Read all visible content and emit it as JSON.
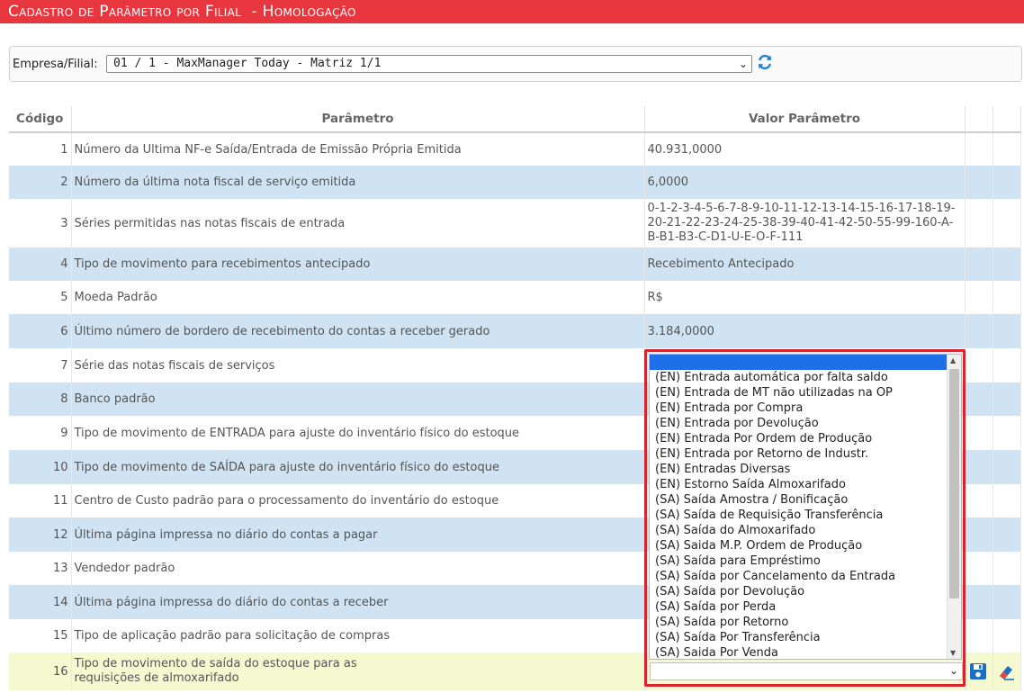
{
  "header": {
    "title": "Cadastro de Parâmetro por Filial  - Homologação"
  },
  "filter": {
    "label": "Empresa/Filial:",
    "value": "01 / 1 - MaxManager Today - Matriz 1/1"
  },
  "table": {
    "columns": [
      "Código",
      "Parâmetro",
      "Valor Parâmetro",
      "",
      ""
    ],
    "rows": [
      {
        "code": "1",
        "param": "Número da Ultima NF-e Saída/Entrada de Emissão Própria Emitida",
        "value": "40.931,0000"
      },
      {
        "code": "2",
        "param": "Número da última nota fiscal de serviço emitida",
        "value": "6,0000"
      },
      {
        "code": "3",
        "param": "Séries permitidas nas notas fiscais de entrada",
        "value": "0-1-2-3-4-5-6-7-8-9-10-11-12-13-14-15-16-17-18-19-20-21-22-23-24-25-38-39-40-41-42-50-55-99-160-A-B-B1-B3-C-D1-U-E-O-F-111"
      },
      {
        "code": "4",
        "param": "Tipo de movimento para recebimentos antecipado",
        "value": "Recebimento Antecipado"
      },
      {
        "code": "5",
        "param": "Moeda Padrão",
        "value": "R$"
      },
      {
        "code": "6",
        "param": "Último número de bordero de recebimento do contas a receber gerado",
        "value": "3.184,0000"
      },
      {
        "code": "7",
        "param": "Série das notas fiscais de serviços",
        "value": ""
      },
      {
        "code": "8",
        "param": "Banco padrão",
        "value": ""
      },
      {
        "code": "9",
        "param": "Tipo de movimento de ENTRADA para ajuste do inventário físico do estoque",
        "value": ""
      },
      {
        "code": "10",
        "param": "Tipo de movimento de SAÍDA para ajuste do inventário físico do estoque",
        "value": ""
      },
      {
        "code": "11",
        "param": "Centro de Custo padrão para o processamento do inventário do estoque",
        "value": ""
      },
      {
        "code": "12",
        "param": "Última página impressa no diário do contas a pagar",
        "value": ""
      },
      {
        "code": "13",
        "param": "Vendedor padrão",
        "value": ""
      },
      {
        "code": "14",
        "param": "Última página impressa do diário do contas a receber",
        "value": ""
      },
      {
        "code": "15",
        "param": "Tipo de aplicação padrão para solicitação de compras",
        "value": ""
      },
      {
        "code": "16",
        "param": "Tipo de movimento de saída do estoque para as requisições de almoxarifado",
        "value": ""
      }
    ]
  },
  "dropdown": {
    "options": [
      "",
      "(EN) Entrada automática por falta saldo",
      "(EN) Entrada de MT não utilizadas na OP",
      "(EN) Entrada por Compra",
      "(EN) Entrada por Devolução",
      "(EN) Entrada Por Ordem de Produção",
      "(EN) Entrada por Retorno de Industr.",
      "(EN) Entradas Diversas",
      "(EN) Estorno Saída Almoxarifado",
      "(SA) Saída Amostra / Bonificação",
      "(SA) Saída de Requisição Transferência",
      "(SA) Saída do Almoxarifado",
      "(SA) Saida M.P. Ordem de Produção",
      "(SA) Saída para Empréstimo",
      "(SA) Saída por Cancelamento da Entrada",
      "(SA) Saída por Devolução",
      "(SA) Saída por Perda",
      "(SA) Saída por Retorno",
      "(SA) Saída Por Transferência",
      "(SA) Saida Por Venda"
    ]
  },
  "colors": {
    "title_bar": "#e8363e",
    "row_alt": "#cfe3f3",
    "row_selected": "#f4f9cf",
    "dropdown_highlight": "#1e6fe8",
    "callout_border": "#d9232d"
  }
}
